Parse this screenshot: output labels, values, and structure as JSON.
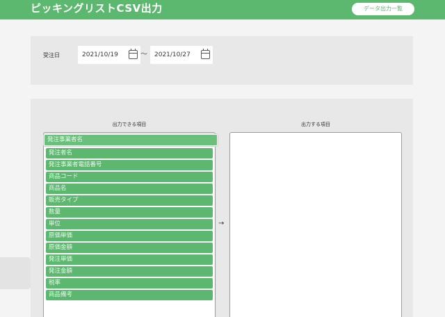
{
  "header": {
    "title": "ピッキングリストCSV出力",
    "export_list_button": "データ出力一覧"
  },
  "date_filter": {
    "label": "受注日",
    "from": "2021/10/19",
    "separator": "〜",
    "to": "2021/10/27"
  },
  "fields": {
    "available_heading": "出力できる項目",
    "selected_heading": "出力する項目",
    "available_items": [
      "発注事業者名",
      "発注者名",
      "発注事業者電話番号",
      "商品コード",
      "商品名",
      "販売タイプ",
      "数量",
      "単位",
      "原価単価",
      "原価金額",
      "発注単価",
      "発注金額",
      "税率",
      "商品備考"
    ],
    "selected_items": [],
    "move_arrow": "→"
  },
  "colors": {
    "brand_green": "#5cb86f"
  }
}
